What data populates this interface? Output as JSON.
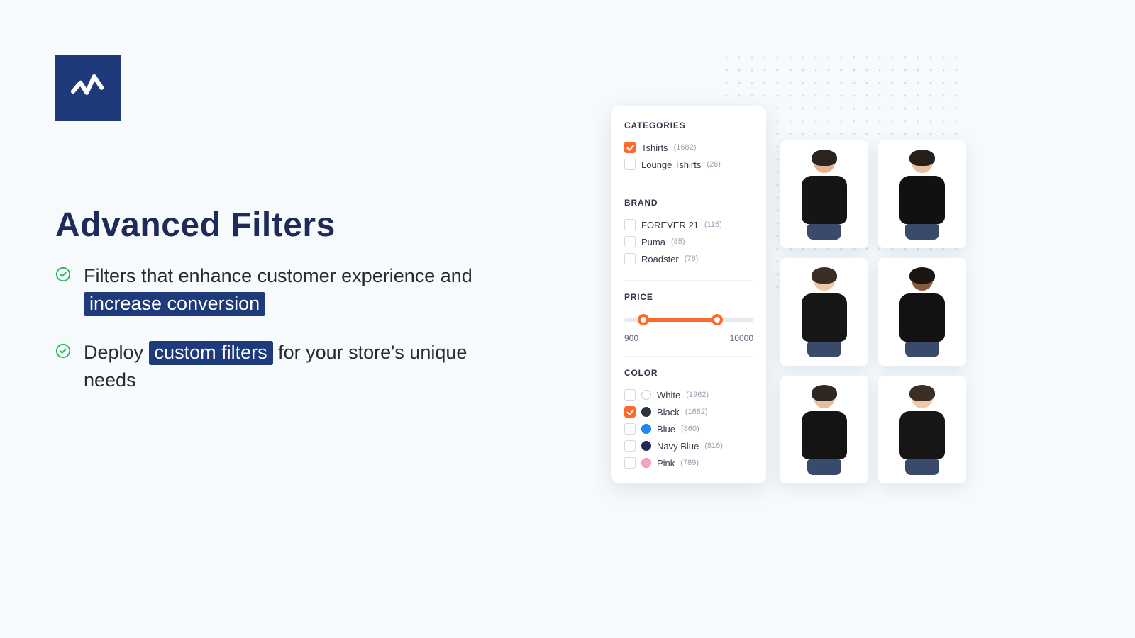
{
  "headline": "Advanced Filters",
  "bullets": [
    {
      "pre": "Filters that enhance customer experience and ",
      "hl": "increase conversion",
      "post": ""
    },
    {
      "pre": "Deploy ",
      "hl": "custom filters",
      "post": " for your store's unique needs"
    }
  ],
  "panel": {
    "categories": {
      "title": "CATEGORIES",
      "items": [
        {
          "label": "Tshirts",
          "count": "(1682)",
          "checked": true
        },
        {
          "label": "Lounge Tshirts",
          "count": "(26)",
          "checked": false
        }
      ]
    },
    "brand": {
      "title": "BRAND",
      "items": [
        {
          "label": "FOREVER 21",
          "count": "(115)",
          "checked": false
        },
        {
          "label": "Puma",
          "count": "(85)",
          "checked": false
        },
        {
          "label": "Roadster",
          "count": "(78)",
          "checked": false
        }
      ]
    },
    "price": {
      "title": "PRICE",
      "min": "900",
      "max": "10000",
      "fill_left_pct": 15,
      "fill_right_pct": 72
    },
    "color": {
      "title": "COLOR",
      "items": [
        {
          "label": "White",
          "count": "(1962)",
          "checked": false,
          "swatch": "#ffffff"
        },
        {
          "label": "Black",
          "count": "(1682)",
          "checked": true,
          "swatch": "#2d333d"
        },
        {
          "label": "Blue",
          "count": "(860)",
          "checked": false,
          "swatch": "#1e88ff"
        },
        {
          "label": "Navy Blue",
          "count": "(816)",
          "checked": false,
          "swatch": "#1e2a5a"
        },
        {
          "label": "Pink",
          "count": "(789)",
          "checked": false,
          "swatch": "#f8a3bf"
        }
      ]
    }
  },
  "products": [
    {
      "skin": "#e3b48f",
      "hair": "#2b2521",
      "shirt": "#151515"
    },
    {
      "skin": "#e8c0a0",
      "hair": "#25201c",
      "shirt": "#111111"
    },
    {
      "skin": "#ecc7a8",
      "hair": "#3a2e26",
      "shirt": "#171717"
    },
    {
      "skin": "#8a5a3d",
      "hair": "#1c1612",
      "shirt": "#121212"
    },
    {
      "skin": "#e6bfa0",
      "hair": "#2e2722",
      "shirt": "#141414"
    },
    {
      "skin": "#efc9ab",
      "hair": "#3b2e22",
      "shirt": "#161616"
    }
  ]
}
